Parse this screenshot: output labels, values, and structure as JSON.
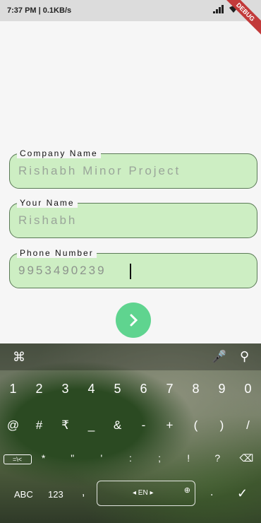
{
  "status_bar": {
    "time": "7:37 PM | 0.1KB/s",
    "wifi_icon": "wifi-icon",
    "signal_icon": "signal-icon",
    "battery_icon": "battery-icon",
    "debug_label": "DEBUG"
  },
  "form": {
    "fields": [
      {
        "label": "Company Name",
        "value": "Rishabh Minor Project"
      },
      {
        "label": "Your Name",
        "value": "Rishabh"
      },
      {
        "label": "Phone Number",
        "value": "9953490239"
      }
    ],
    "next_icon": "chevron-right-icon",
    "next_color": "#5fd48f",
    "field_bg": "#cdeec3"
  },
  "keyboard": {
    "toolbar": {
      "command": "⌘",
      "mic": "🎤",
      "search": "⚲"
    },
    "num_row": [
      "1",
      "2",
      "3",
      "4",
      "5",
      "6",
      "7",
      "8",
      "9",
      "0"
    ],
    "sym_row": [
      "@",
      "#",
      "₹",
      "_",
      "&",
      "-",
      "+",
      "(",
      ")",
      "/"
    ],
    "third_row": [
      "=\\<",
      "*",
      "\"",
      "'",
      ":",
      ";",
      "!",
      "?",
      "⌫"
    ],
    "bottom": {
      "abc": "ABC",
      "num": "123",
      "comma": ",",
      "space_lang": "◂ EN ▸",
      "globe": "⊕",
      "dot": ".",
      "enter": "✓"
    }
  }
}
